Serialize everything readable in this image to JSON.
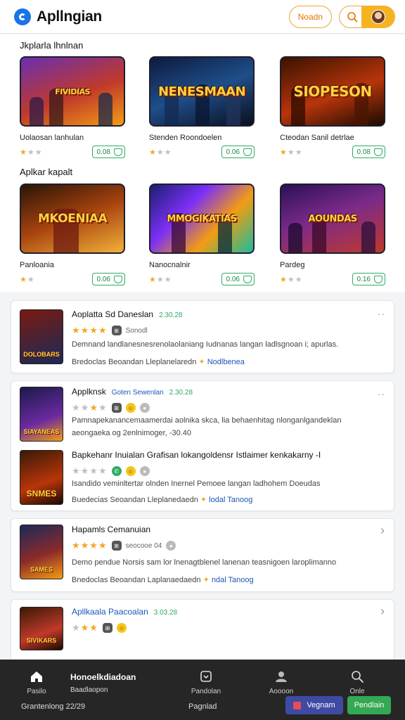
{
  "header": {
    "title": "Apllngian",
    "action_label": "Noadn",
    "icons": [
      "app-logo-icon",
      "search-icon",
      "user-avatar"
    ]
  },
  "grid": {
    "sections": [
      {
        "label": "Jkplarla lhnlnan",
        "cards": [
          {
            "thumb_text": "FIVIDIAS",
            "name": "Uolaosan lanhulan",
            "stars": 1,
            "price": "0.08"
          },
          {
            "thumb_text": "NENESMAAN",
            "name": "Stenden Roondoelen",
            "stars": 1,
            "price": "0.06"
          },
          {
            "thumb_text": "SIOPESON",
            "name": "Cteodan Sanil detrlae",
            "stars": 1,
            "price": "0.08"
          }
        ]
      },
      {
        "label": "Aplkar kapalt",
        "cards": [
          {
            "thumb_text": "MKOENIAA",
            "name": "Panloania",
            "stars": 1,
            "price": "0.06"
          },
          {
            "thumb_text": "MMOGIKATIAS",
            "name": "Nanocnalnir",
            "stars": 1,
            "price": "0.06"
          },
          {
            "thumb_text": "AOUNDAS",
            "name": "Pardeg",
            "stars": 1,
            "price": "0.16"
          }
        ]
      }
    ]
  },
  "feed": [
    {
      "entries": [
        {
          "thumb_text": "DOLOBARS",
          "title": "Aoplatta Sd Daneslan",
          "tag": "2.30.28",
          "stars": 4,
          "stats": "Sonodl",
          "desc": "Demnand landlanesnesrenolaolaniang Iudnanas langan ladlsgnoan i; apurlas.",
          "foot_prefix": "Bredoclas Beoandan Lleplanelaredn",
          "foot_link": "Nodlbenea"
        }
      ],
      "more": "··"
    },
    {
      "entries": [
        {
          "thumb_text": "SIAYANEAS",
          "title": "Applknsk",
          "title2": "Goten Sewenlan",
          "tag": "2.30.28",
          "stars": 3,
          "stats": "",
          "desc": "Pamnapekanancemaamerdai aolnika skca, lia behaenhitag nlonganlgandeklan",
          "desc2": "aeongaeka og 2enlnimoger, -30.40",
          "foot_prefix": "",
          "foot_link": ""
        },
        {
          "thumb_text": "SNMES",
          "title": "Bapkehanr Inuialan Grafisan lokangoldensr Istlaimer kenkakarny -I",
          "tag": "",
          "stars": 0,
          "stats": "",
          "desc": "Isandido veminltertar olnden Inernel Pemoee langan ladhohem Doeudas",
          "foot_prefix": "Buedecias Seoandan Lleplanedaedn",
          "foot_link": "lodal Tanoog"
        }
      ],
      "more": "··"
    },
    {
      "entries": [
        {
          "thumb_text": "SAMES",
          "title": "Hapamls Cemanuian",
          "tag": "",
          "stars": 4,
          "stats": "seocooe 04",
          "desc": "Demo pendue Norsis sam lor lnenagtblenel lanenan teasnigoen laroplimanno",
          "foot_prefix": "Bnedoclas Beoandan Laplanaedaedn",
          "foot_link": "ndal Tanoog"
        }
      ],
      "more": "›"
    },
    {
      "entries": [
        {
          "thumb_text": "SIVIKARS",
          "title": "Apllkaala Paacoalan",
          "tag": "3.03.28",
          "stars": 3,
          "stats": "",
          "desc": "",
          "foot_prefix": "",
          "foot_link": ""
        }
      ],
      "more": "›"
    }
  ],
  "bottom_nav": {
    "home_label": "Pasilo",
    "center_title": "Honoelkdiadoan",
    "center_sub": "Baadlaopon",
    "center_label": "Pandolan",
    "people_label": "Aoooon",
    "search_label": "Onle",
    "left_footer": "Grantenlong 22/29",
    "center_footer": "Pagnlad",
    "btn_secondary": "Vegnam",
    "btn_primary": "Pendlain"
  },
  "colors": {
    "accent_orange": "#f0a23b",
    "accent_green": "#2eaa66",
    "brand_blue": "#1a73e8",
    "nav_bg": "#262626",
    "btn_purple": "#3f4aa3",
    "btn_green": "#34a853"
  }
}
